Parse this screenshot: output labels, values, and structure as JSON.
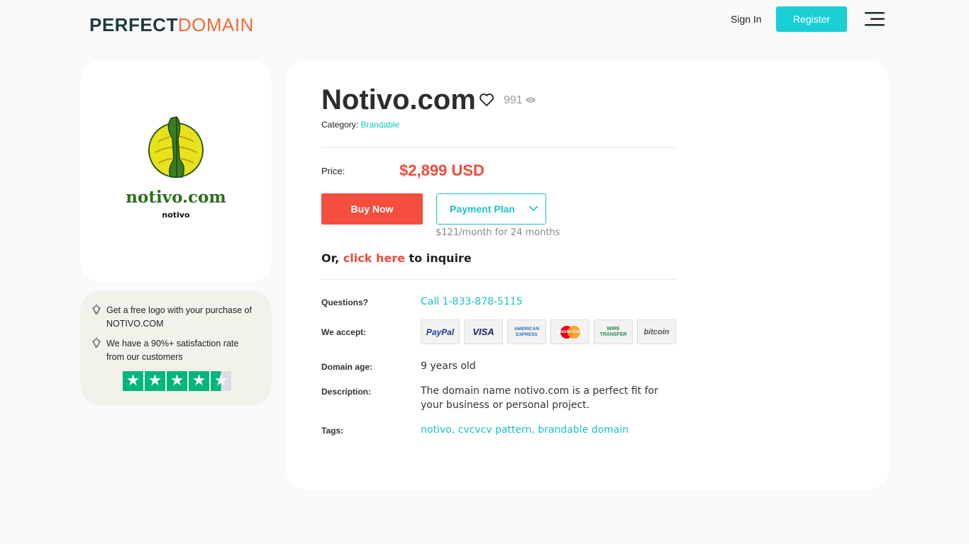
{
  "header": {
    "logo_part1": "PERFECT",
    "logo_part2": "DOMAIN",
    "sign_in": "Sign In",
    "register": "Register"
  },
  "logo_card": {
    "wordmark": "notivo.com",
    "sub": "notivo"
  },
  "info_card": {
    "items": [
      {
        "line1": "Get a free logo with your purchase of",
        "line2": "NOTIVO.COM"
      },
      {
        "line1": "We have a 90%+ satisfaction rate",
        "line2": "from our customers"
      }
    ],
    "rating_stars": 4.5
  },
  "listing": {
    "domain": "Notivo.com",
    "views": "991",
    "category_label": "Category:",
    "category": "Brandable",
    "price_label": "Price:",
    "price": "$2,899 USD",
    "buy_now": "Buy Now",
    "payment_plan": "Payment Plan",
    "plan_note": "$121/month for 24 months",
    "inquire_prefix": "Or,",
    "inquire_link": "click here",
    "inquire_suffix": "to inquire",
    "questions_label": "Questions?",
    "questions_value": "Call 1-833-878-5115",
    "accept_label": "We accept:",
    "payments": [
      "PayPal",
      "VISA",
      "AMERICAN EXPRESS",
      "MasterCard",
      "WIRE TRANSFER",
      "bitcoin"
    ],
    "age_label": "Domain age:",
    "age_value": "9 years old",
    "description_label": "Description:",
    "description_line1": "The domain name notivo.com is a perfect fit for",
    "description_line2": "your business or personal project.",
    "tags_label": "Tags:",
    "tags_value": "notivo, cvcvcv pattern, brandable domain"
  },
  "colors": {
    "accent": "#1ac1c7",
    "price": "#f04b3b",
    "buy": "#f44e3f",
    "trustpilot": "#00b67a"
  }
}
